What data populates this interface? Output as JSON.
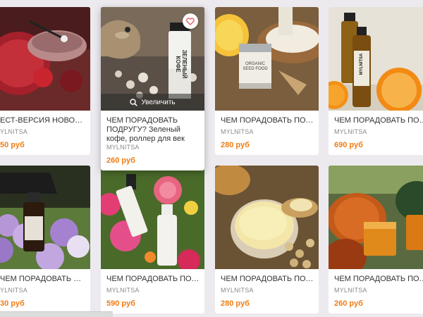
{
  "products": [
    {
      "title": "ест-версия новой маски д...",
      "author": "YLNITSA",
      "price": "50 руб"
    },
    {
      "title": "ЧЕМ ПОРАДОВАТЬ ПОДРУГУ? Зеленый кофе, роллер для век",
      "author": "MYLNITSA",
      "price": "260 руб",
      "zoom_label": "Увеличить"
    },
    {
      "title": "ЧЕМ ПОРАДОВАТЬ ПОДРУ...",
      "author": "MYLNITSA",
      "price": "280 руб"
    },
    {
      "title": "ЧЕМ ПОРАДОВАТЬ ПОДРУ...",
      "author": "MYLNITSA",
      "price": "690 руб"
    },
    {
      "title": "ЧЕМ ПОРАДОВАТЬ ПОДРУ...",
      "author": "YLNITSA",
      "price": "30 руб"
    },
    {
      "title": "ЧЕМ ПОРАДОВАТЬ ПОДРУ...",
      "author": "MYLNITSA",
      "price": "590 руб"
    },
    {
      "title": "ЧЕМ ПОРАДОВАТЬ ПОДРУ...",
      "author": "MYLNITSA",
      "price": "280 руб"
    },
    {
      "title": "ЧЕМ ПОРАДОВАТЬ ПОДРУ...",
      "author": "MYLNITSA",
      "price": "260 руб"
    }
  ],
  "image_text": {
    "bottle_label": "ЗЕЛЕНЫЙ КОФЕ",
    "jar_label": "ORGANIC SEED FOOD",
    "oil_label": "MYLNITSA",
    "spray_label": "MYLNITSA"
  },
  "icons": {
    "zoom": "magnifier-icon",
    "favorite": "heart-icon"
  },
  "colors": {
    "price": "#ef7d14",
    "background": "#eceaee"
  }
}
